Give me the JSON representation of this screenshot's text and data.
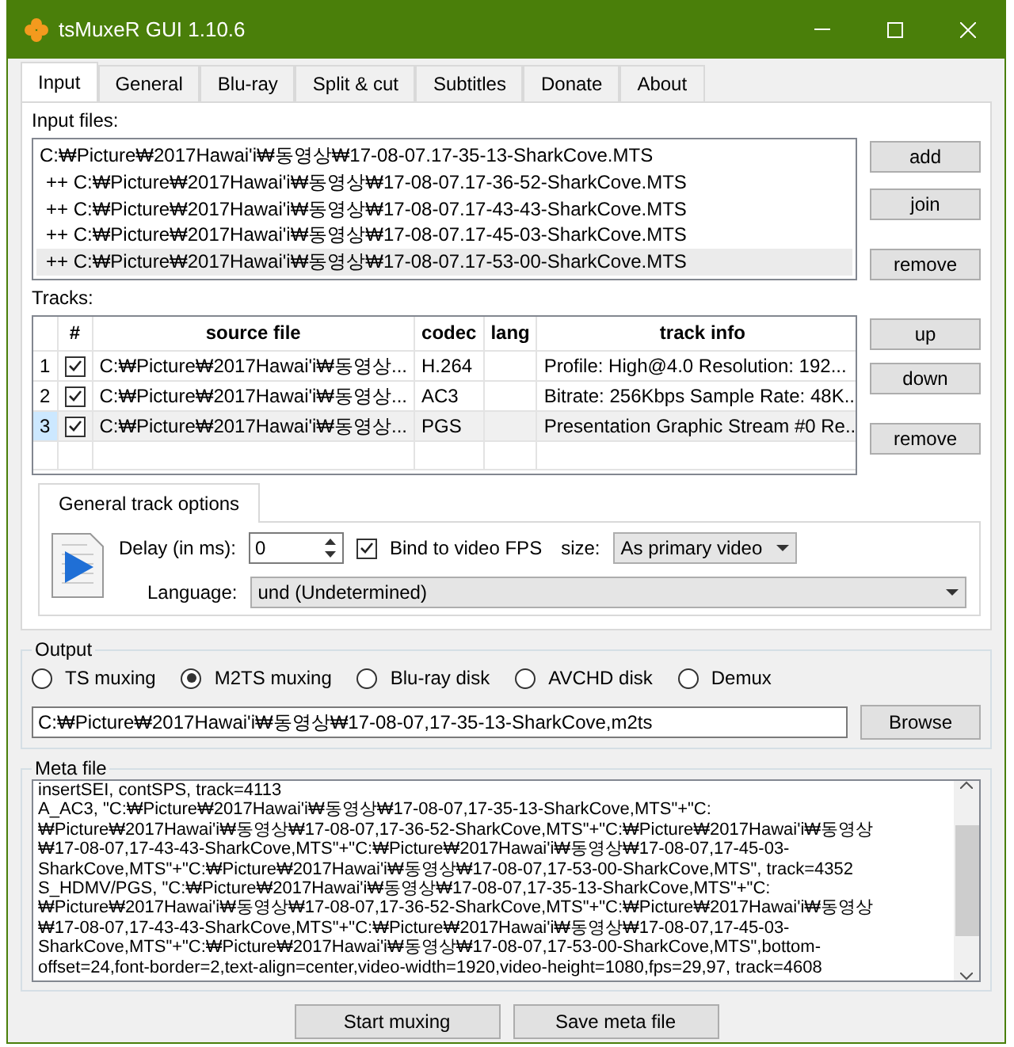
{
  "window": {
    "title": "tsMuxeR GUI 1.10.6"
  },
  "tabs": [
    {
      "label": "Input",
      "selected": true
    },
    {
      "label": "General",
      "selected": false
    },
    {
      "label": "Blu-ray",
      "selected": false
    },
    {
      "label": "Split & cut",
      "selected": false
    },
    {
      "label": "Subtitles",
      "selected": false
    },
    {
      "label": "Donate",
      "selected": false
    },
    {
      "label": "About",
      "selected": false
    }
  ],
  "input_files": {
    "label": "Input files:",
    "files": [
      {
        "text": "C:₩Picture₩2017Hawai'i₩동영상₩17-08-07.17-35-13-SharkCove.MTS",
        "selected": false,
        "kind": "main"
      },
      {
        "text": "++ C:₩Picture₩2017Hawai'i₩동영상₩17-08-07.17-36-52-SharkCove.MTS",
        "selected": false,
        "kind": "joined"
      },
      {
        "text": "++ C:₩Picture₩2017Hawai'i₩동영상₩17-08-07.17-43-43-SharkCove.MTS",
        "selected": false,
        "kind": "joined"
      },
      {
        "text": "++ C:₩Picture₩2017Hawai'i₩동영상₩17-08-07.17-45-03-SharkCove.MTS",
        "selected": false,
        "kind": "joined"
      },
      {
        "text": "++ C:₩Picture₩2017Hawai'i₩동영상₩17-08-07.17-53-00-SharkCove.MTS",
        "selected": true,
        "kind": "joined"
      }
    ],
    "buttons": [
      "add",
      "join",
      "remove"
    ]
  },
  "tracks": {
    "label": "Tracks:",
    "columns": [
      "#",
      "source file",
      "codec",
      "lang",
      "track info"
    ],
    "rows": [
      {
        "number": "1",
        "checked": true,
        "source": "C:₩Picture₩2017Hawai'i₩동영상...",
        "codec": "H.264",
        "info": "Profile: High@4.0  Resolution: 192...",
        "selected": false
      },
      {
        "number": "2",
        "checked": true,
        "source": "C:₩Picture₩2017Hawai'i₩동영상...",
        "codec": "AC3",
        "info": "Bitrate: 256Kbps Sample Rate: 48K...",
        "selected": false
      },
      {
        "number": "3",
        "checked": true,
        "source": "C:₩Picture₩2017Hawai'i₩동영상...",
        "codec": "PGS",
        "info": "Presentation Graphic Stream #0 Re...",
        "selected": true
      }
    ],
    "buttons": [
      "up",
      "down",
      "remove"
    ]
  },
  "track_options": {
    "tab": "General track options",
    "delay_label": "Delay (in ms):",
    "delay_value": "0",
    "bind_label": "Bind to video FPS",
    "bind_checked": true,
    "size_label": "size:",
    "size_value": "As primary video",
    "language_label": "Language:",
    "language_value": "und (Undetermined)"
  },
  "output": {
    "label": "Output",
    "modes": [
      {
        "label": "TS muxing",
        "selected": false
      },
      {
        "label": "M2TS muxing",
        "selected": true
      },
      {
        "label": "Blu-ray disk",
        "selected": false
      },
      {
        "label": "AVCHD disk",
        "selected": false
      },
      {
        "label": "Demux",
        "selected": false
      }
    ],
    "path": "C:₩Picture₩2017Hawai'i₩동영상₩17-08-07,17-35-13-SharkCove,m2ts",
    "browse": "Browse"
  },
  "meta": {
    "label": "Meta file",
    "lines": [
      "insertSEI, contSPS, track=4113",
      "A_AC3, \"C:₩Picture₩2017Hawai'i₩동영상₩17-08-07,17-35-13-SharkCove,MTS\"+\"C:",
      "₩Picture₩2017Hawai'i₩동영상₩17-08-07,17-36-52-SharkCove,MTS\"+\"C:₩Picture₩2017Hawai'i₩동영상",
      "₩17-08-07,17-43-43-SharkCove,MTS\"+\"C:₩Picture₩2017Hawai'i₩동영상₩17-08-07,17-45-03-",
      "SharkCove,MTS\"+\"C:₩Picture₩2017Hawai'i₩동영상₩17-08-07,17-53-00-SharkCove,MTS\", track=4352",
      "S_HDMV/PGS, \"C:₩Picture₩2017Hawai'i₩동영상₩17-08-07,17-35-13-SharkCove,MTS\"+\"C:",
      "₩Picture₩2017Hawai'i₩동영상₩17-08-07,17-36-52-SharkCove,MTS\"+\"C:₩Picture₩2017Hawai'i₩동영상",
      "₩17-08-07,17-43-43-SharkCove,MTS\"+\"C:₩Picture₩2017Hawai'i₩동영상₩17-08-07,17-45-03-",
      "SharkCove,MTS\"+\"C:₩Picture₩2017Hawai'i₩동영상₩17-08-07,17-53-00-SharkCove,MTS\",bottom-",
      "offset=24,font-border=2,text-align=center,video-width=1920,video-height=1080,fps=29,97, track=4608"
    ]
  },
  "buttons": [
    "Start muxing",
    "Save meta file"
  ]
}
